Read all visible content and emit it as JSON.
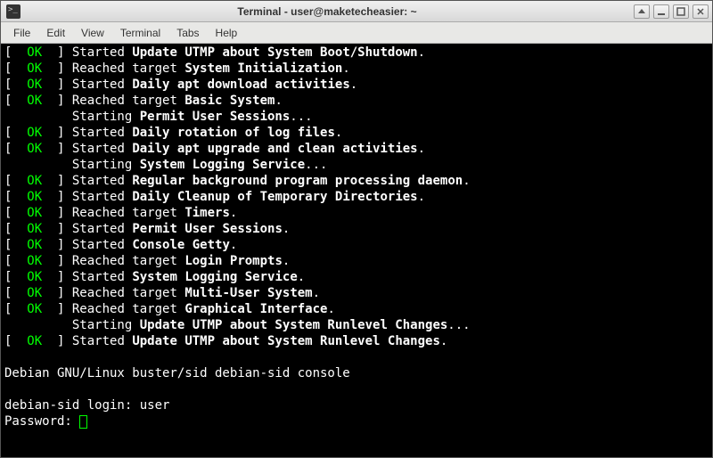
{
  "window": {
    "title": "Terminal - user@maketecheasier: ~"
  },
  "menubar": [
    "File",
    "Edit",
    "View",
    "Terminal",
    "Tabs",
    "Help"
  ],
  "ok_text": "OK",
  "prefix": "[  ",
  "suffix": "  ] ",
  "no_status_pad": "         ",
  "boot_lines": [
    {
      "ok": true,
      "verb": "Started ",
      "bold": "Update UTMP about System Boot/Shutdown",
      "trail": "."
    },
    {
      "ok": true,
      "verb": "Reached target ",
      "bold": "System Initialization",
      "trail": "."
    },
    {
      "ok": true,
      "verb": "Started ",
      "bold": "Daily apt download activities",
      "trail": "."
    },
    {
      "ok": true,
      "verb": "Reached target ",
      "bold": "Basic System",
      "trail": "."
    },
    {
      "ok": false,
      "verb": "Starting ",
      "bold": "Permit User Sessions",
      "trail": "..."
    },
    {
      "ok": true,
      "verb": "Started ",
      "bold": "Daily rotation of log files",
      "trail": "."
    },
    {
      "ok": true,
      "verb": "Started ",
      "bold": "Daily apt upgrade and clean activities",
      "trail": "."
    },
    {
      "ok": false,
      "verb": "Starting ",
      "bold": "System Logging Service",
      "trail": "..."
    },
    {
      "ok": true,
      "verb": "Started ",
      "bold": "Regular background program processing daemon",
      "trail": "."
    },
    {
      "ok": true,
      "verb": "Started ",
      "bold": "Daily Cleanup of Temporary Directories",
      "trail": "."
    },
    {
      "ok": true,
      "verb": "Reached target ",
      "bold": "Timers",
      "trail": "."
    },
    {
      "ok": true,
      "verb": "Started ",
      "bold": "Permit User Sessions",
      "trail": "."
    },
    {
      "ok": true,
      "verb": "Started ",
      "bold": "Console Getty",
      "trail": "."
    },
    {
      "ok": true,
      "verb": "Reached target ",
      "bold": "Login Prompts",
      "trail": "."
    },
    {
      "ok": true,
      "verb": "Started ",
      "bold": "System Logging Service",
      "trail": "."
    },
    {
      "ok": true,
      "verb": "Reached target ",
      "bold": "Multi-User System",
      "trail": "."
    },
    {
      "ok": true,
      "verb": "Reached target ",
      "bold": "Graphical Interface",
      "trail": "."
    },
    {
      "ok": false,
      "verb": "Starting ",
      "bold": "Update UTMP about System Runlevel Changes",
      "trail": "..."
    },
    {
      "ok": true,
      "verb": "Started ",
      "bold": "Update UTMP about System Runlevel Changes",
      "trail": "."
    }
  ],
  "banner": "Debian GNU/Linux buster/sid debian-sid console",
  "login_prompt": "debian-sid login: ",
  "login_user": "user",
  "password_prompt": "Password: "
}
